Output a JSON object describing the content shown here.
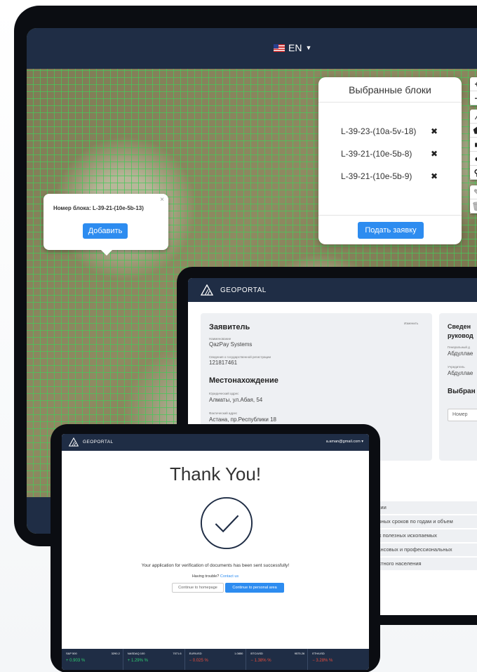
{
  "map_app": {
    "language": "EN",
    "selected_blocks_title": "Выбранные блоки",
    "selected_blocks": [
      {
        "code": "L-39-23-(10a-5v-18)",
        "remove": "✖"
      },
      {
        "code": "L-39-21-(10e-5b-8)",
        "remove": "✖"
      },
      {
        "code": "L-39-21-(10e-5b-9)",
        "remove": "✖"
      }
    ],
    "submit_label": "Подать заявку",
    "popup_title": "Номер блока: L-39-21-(10e-5b-13)",
    "popup_close": "×",
    "add_label": "Добавить",
    "zoom_in": "+",
    "zoom_out": "−",
    "draw_tools": [
      "⁄",
      "⬟",
      "■",
      "●",
      "⚲"
    ],
    "edit_tools": [
      "✎",
      "🗑"
    ]
  },
  "geoportal_form": {
    "brand": "GEOPORTAL",
    "applicant_title": "Заявитель",
    "change_label": "Изменить",
    "name_label": "Наименование",
    "name_value": "QazPay Systems",
    "reg_label": "Сведения о государственной регистрации",
    "reg_value": "121817461",
    "location_title": "Местонахождение",
    "legal_addr_label": "Юридический адрес",
    "legal_addr_value": "Алматы, ул.Абая, 54",
    "actual_addr_label": "Фактический адрес",
    "actual_addr_value": "Астана, пр.Республики 18",
    "side_title_1": "Сведен",
    "side_title_2": "руковод",
    "director_label": "Генеральный д",
    "director_value": "Абдуллае",
    "founder_label": "Учредитель",
    "founder_value": "Абдуллае",
    "selected_title": "Выбран",
    "select_placeholder": "Номер",
    "list_items": [
      "пании",
      "мерных сроков по годам и объем",
      "дых полезных ископаемых",
      "инансовых и профессиональных",
      "местного населения"
    ]
  },
  "thank_you": {
    "brand": "GEOPORTAL",
    "email": "a.aman@gmail.com ▾",
    "heading": "Thank You!",
    "message": "Your application for verification of documents has been sent successfully!",
    "trouble_text": "Having trouble? ",
    "contact_link": "Contact us",
    "home_button": "Continue to homepage",
    "personal_button": "Continue to personal area",
    "ticker": [
      {
        "name": "S&P 500",
        "value": "3290.2",
        "change": "+ 0.903 %",
        "dir": "up"
      },
      {
        "name": "NASDAQ 100",
        "value": "7071.6",
        "change": "+ 1.29% %",
        "dir": "up"
      },
      {
        "name": "EUR/USD",
        "value": "1.0850",
        "change": "− 0.025 %",
        "dir": "down"
      },
      {
        "name": "BTC/USD",
        "value": "9575.26",
        "change": "− 1.38% %",
        "dir": "down"
      },
      {
        "name": "ETH/USD",
        "value": "",
        "change": "− 3.28% %",
        "dir": "down"
      }
    ]
  },
  "colors": {
    "navy": "#1f2d45",
    "accent": "#2d8cf0",
    "grid": "#46c85a"
  }
}
